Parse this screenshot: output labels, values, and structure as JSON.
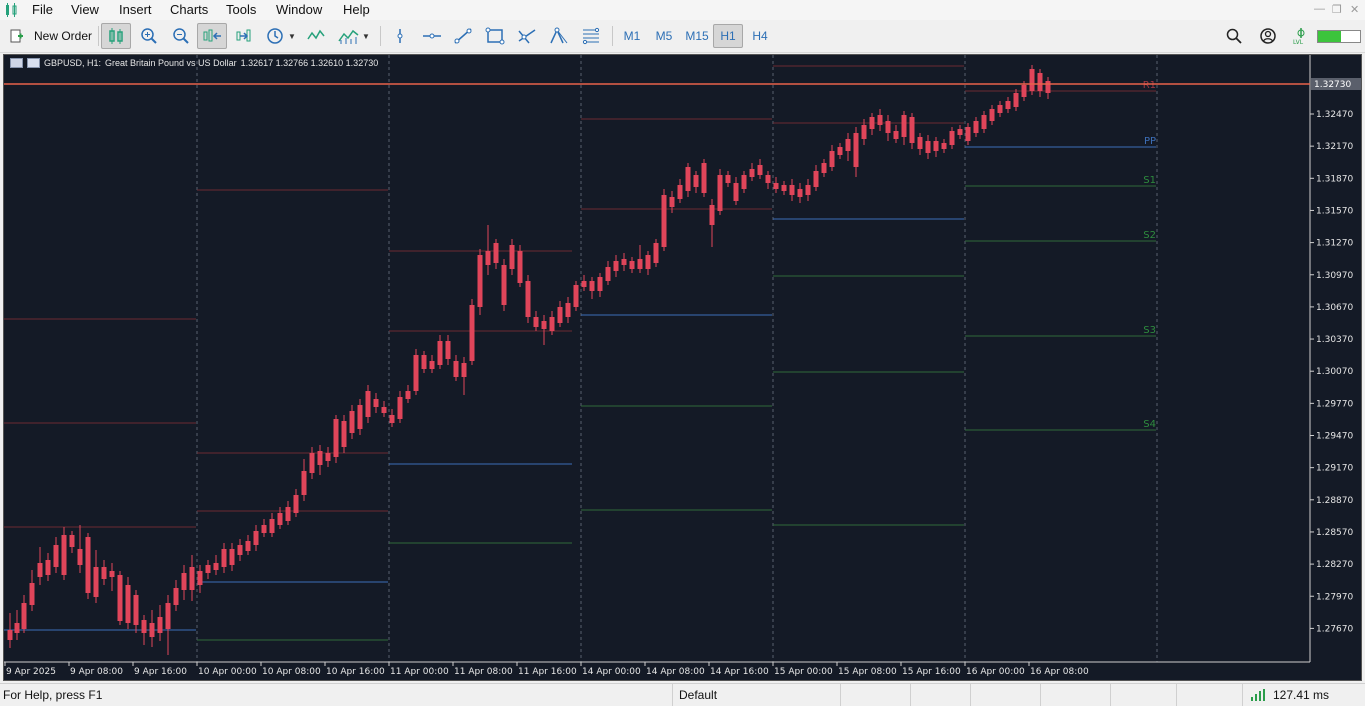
{
  "menu": [
    "File",
    "View",
    "Insert",
    "Charts",
    "Tools",
    "Window",
    "Help"
  ],
  "toolbar": {
    "new_order_label": "New Order",
    "timeframes": [
      "M1",
      "M5",
      "M15",
      "H1",
      "H4"
    ],
    "active_timeframe": "H1",
    "icons": [
      "bar-chart-icon",
      "candles-icon",
      "zoom-in-icon",
      "zoom-out-icon",
      "chart-shift-icon",
      "autoscroll-icon",
      "periods-clock-icon",
      "indicators-icon",
      "one-click-trading-icon",
      "vertical-line-icon",
      "horizontal-line-icon",
      "trendline-icon",
      "rectangle-icon",
      "cycle-lines-icon",
      "text-draw-icon",
      "fibonacci-icon",
      "search-icon",
      "account-icon",
      "signal-level-icon",
      "connection-bar-icon"
    ]
  },
  "chart": {
    "symbol": "GBPUSD, H1:",
    "description": "Great Britain Pound vs US Dollar",
    "ohlc": "1.32617 1.32766 1.32610 1.32730",
    "current_price_label": "1.32730",
    "price_axis": [
      "1.32470",
      "1.32170",
      "1.31870",
      "1.31570",
      "1.31270",
      "1.30970",
      "1.30670",
      "1.30370",
      "1.30070",
      "1.29770",
      "1.29470",
      "1.29170",
      "1.28870",
      "1.28570",
      "1.28270",
      "1.27970",
      "1.27670"
    ],
    "time_axis": [
      "9 Apr 2025",
      "9 Apr 08:00",
      "9 Apr 16:00",
      "10 Apr 00:00",
      "10 Apr 08:00",
      "10 Apr 16:00",
      "11 Apr 00:00",
      "11 Apr 08:00",
      "11 Apr 16:00",
      "14 Apr 00:00",
      "14 Apr 08:00",
      "14 Apr 16:00",
      "15 Apr 00:00",
      "15 Apr 08:00",
      "15 Apr 16:00",
      "16 Apr 00:00",
      "16 Apr 08:00"
    ],
    "pivot_labels": [
      "R1",
      "PP",
      "S1",
      "S2",
      "S3",
      "S4"
    ],
    "colors": {
      "background": "#141a26",
      "bull": "#26a17b",
      "bear": "#e0455a",
      "pp": "#3d6fb8",
      "support": "#2f6b3a",
      "resistance": "#6b2a33",
      "price_line": "#e8634a"
    }
  },
  "status": {
    "help": "For Help, press F1",
    "profile": "Default",
    "ping": "127.41 ms"
  }
}
